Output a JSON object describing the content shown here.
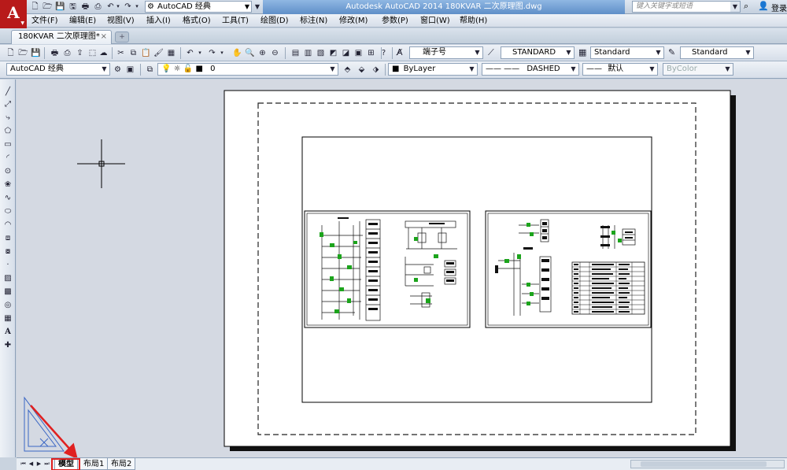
{
  "title_bar": {
    "workspace": "AutoCAD 经典",
    "title": "Autodesk AutoCAD 2014    180KVAR 二次原理图.dwg",
    "search_placeholder": "键入关键字或短语",
    "login": "登录"
  },
  "menu": {
    "items": [
      "文件(F)",
      "编辑(E)",
      "视图(V)",
      "插入(I)",
      "格式(O)",
      "工具(T)",
      "绘图(D)",
      "标注(N)",
      "修改(M)",
      "参数(P)",
      "窗口(W)",
      "帮助(H)"
    ]
  },
  "document": {
    "tab_name": "180KVAR 二次原理图*",
    "close_glyph": "×"
  },
  "styles": {
    "text_style": "端子号",
    "dim_style": "STANDARD",
    "table_style": "Standard",
    "multileader_style": "Standard"
  },
  "layers": {
    "workspace": "AutoCAD 经典",
    "current_layer": "0",
    "color": "ByLayer",
    "linetype": "DASHED",
    "lineweight": "默认",
    "plot_style": "ByColor"
  },
  "layout_tabs": [
    "模型",
    "布局1",
    "布局2"
  ],
  "colors": {
    "accent_red": "#e02020",
    "title_blue": "#5f8fc8",
    "logo_red": "#b81a1a",
    "canvas_bg": "#d4d9e2",
    "schematic_green": "#1ca41c"
  },
  "icons": {
    "draw_tools": [
      "line-icon",
      "construction-line-icon",
      "polyline-icon",
      "polygon-icon",
      "rectangle-icon",
      "arc-icon",
      "circle-icon",
      "revision-cloud-icon",
      "spline-icon",
      "ellipse-icon",
      "ellipse-arc-icon",
      "insert-block-icon",
      "make-block-icon",
      "point-icon",
      "hatch-icon",
      "gradient-icon",
      "region-icon",
      "table-icon",
      "multiline-text-icon",
      "add-selected-icon"
    ]
  }
}
